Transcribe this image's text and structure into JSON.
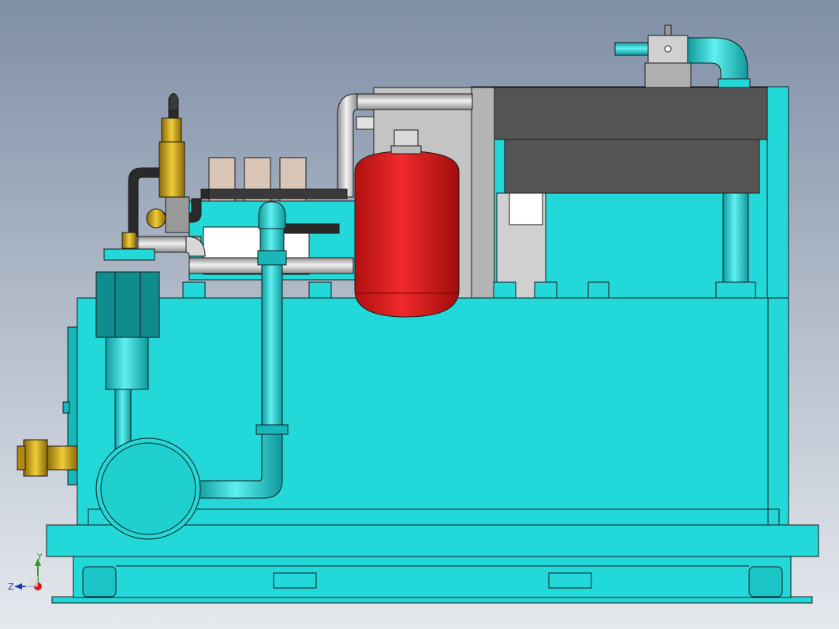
{
  "viewport": {
    "background_top": "#7f8fa6",
    "background_bottom": "#e6e9ee"
  },
  "colors": {
    "tank": "#22d8d8",
    "tank_dark": "#10a8aa",
    "tank_shade": "#0e8c8e",
    "outline": "#1a1a1a",
    "accumulator": "#d81818",
    "accumulator_dark": "#8a0a0a",
    "steel": "#c8c8c8",
    "steel_dark": "#9a9a9a",
    "hose": "#2a2a2a",
    "brass": "#c9a21a",
    "panel": "#555555",
    "valve_block": "#d9c6b6"
  },
  "triad": {
    "x_label": "Z",
    "y_label": "Y"
  }
}
